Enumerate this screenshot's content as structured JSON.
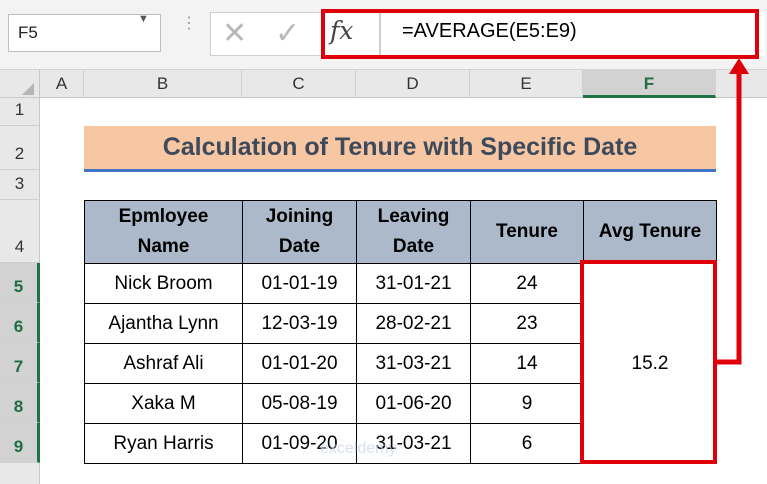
{
  "formula_bar": {
    "name_box": "F5",
    "fx_label": "fx",
    "formula": "=AVERAGE(E5:E9)"
  },
  "columns": [
    "A",
    "B",
    "C",
    "D",
    "E",
    "F"
  ],
  "rows": [
    "1",
    "2",
    "3",
    "4",
    "5",
    "6",
    "7",
    "8",
    "9"
  ],
  "sheet": {
    "title": "Calculation of Tenure with Specific Date",
    "headers": {
      "name": [
        "Epmloyee",
        "Name"
      ],
      "joining": [
        "Joining",
        "Date"
      ],
      "leaving": [
        "Leaving",
        "Date"
      ],
      "tenure": "Tenure",
      "avg": "Avg Tenure"
    },
    "records": [
      {
        "name": "Nick Broom",
        "joining": "01-01-19",
        "leaving": "31-01-21",
        "tenure": "24"
      },
      {
        "name": "Ajantha Lynn",
        "joining": "12-03-19",
        "leaving": "28-02-21",
        "tenure": "23"
      },
      {
        "name": "Ashraf Ali",
        "joining": "01-01-20",
        "leaving": "31-03-21",
        "tenure": "14"
      },
      {
        "name": "Xaka M",
        "joining": "05-08-19",
        "leaving": "01-06-20",
        "tenure": "9"
      },
      {
        "name": "Ryan Harris",
        "joining": "01-09-20",
        "leaving": "31-03-21",
        "tenure": "6"
      }
    ],
    "avg_tenure": "15.2"
  },
  "watermark": "exceldemy",
  "colors": {
    "highlight": "#e0000a",
    "title_fill": "#f7c6a2",
    "header_fill": "#acb9ca",
    "accent_green": "#217346"
  }
}
